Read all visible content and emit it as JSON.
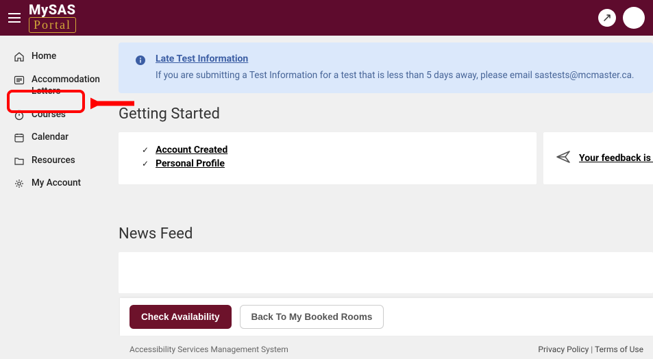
{
  "header": {
    "logo_line1": "MySAS",
    "logo_line2": "Portal"
  },
  "sidebar": {
    "items": [
      {
        "label": "Home",
        "icon": "home"
      },
      {
        "label": "Accommodation Letters",
        "icon": "letters"
      },
      {
        "label": "Courses",
        "icon": "stopwatch"
      },
      {
        "label": "Calendar",
        "icon": "calendar"
      },
      {
        "label": "Resources",
        "icon": "folder"
      },
      {
        "label": "My Account",
        "icon": "gear"
      }
    ]
  },
  "alert": {
    "title": "Late Test Information",
    "body": "If you are submitting a Test Information for a test that is less than 5 days away, please email sastests@mcmaster.ca."
  },
  "getting_started": {
    "title": "Getting Started",
    "items": [
      "Account Created",
      "Personal Profile"
    ]
  },
  "feedback": {
    "label": "Your feedback is welc"
  },
  "news_feed": {
    "title": "News Feed"
  },
  "floating_bar": {
    "primary": "Check Availability",
    "secondary": "Back To My Booked Rooms"
  },
  "footer": {
    "left": "Accessibility Services Management System",
    "right_privacy": "Privacy Policy",
    "right_terms": "Terms of Use",
    "sep": " | "
  }
}
